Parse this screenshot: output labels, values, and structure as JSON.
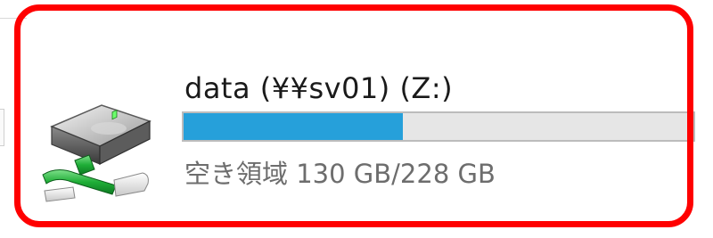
{
  "drive": {
    "name": "data (¥¥sv01) (Z:)",
    "icon": "network-drive-icon",
    "used_fraction": 0.43,
    "free_space_text": "空き領域 130 GB/228 GB"
  },
  "colors": {
    "highlight": "#ff0000",
    "bar_fill": "#26a0da",
    "bar_track": "#e6e6e6"
  }
}
